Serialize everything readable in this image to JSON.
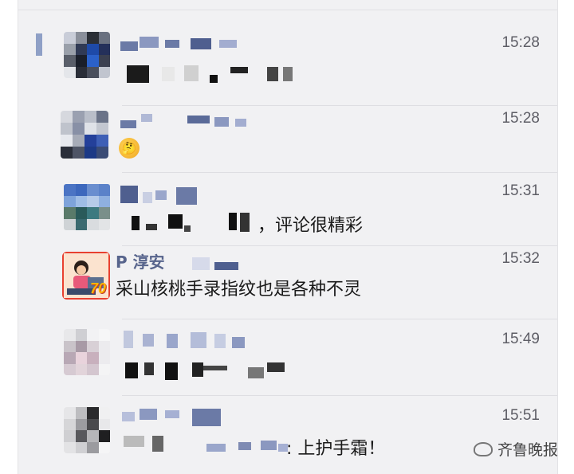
{
  "chat": {
    "messages": [
      {
        "time": "15:28"
      },
      {
        "time": "15:28"
      },
      {
        "time": "15:31",
        "text_suffix": "，评论很精彩"
      },
      {
        "name": "P 淳安",
        "time": "15:32",
        "text": "采山核桃手录指纹也是各种不灵",
        "avatar_badge": "70"
      },
      {
        "time": "15:49"
      },
      {
        "time": "15:51",
        "text_suffix": ": 上护手霜！"
      }
    ]
  },
  "watermark": {
    "label": "齐鲁晚报"
  }
}
